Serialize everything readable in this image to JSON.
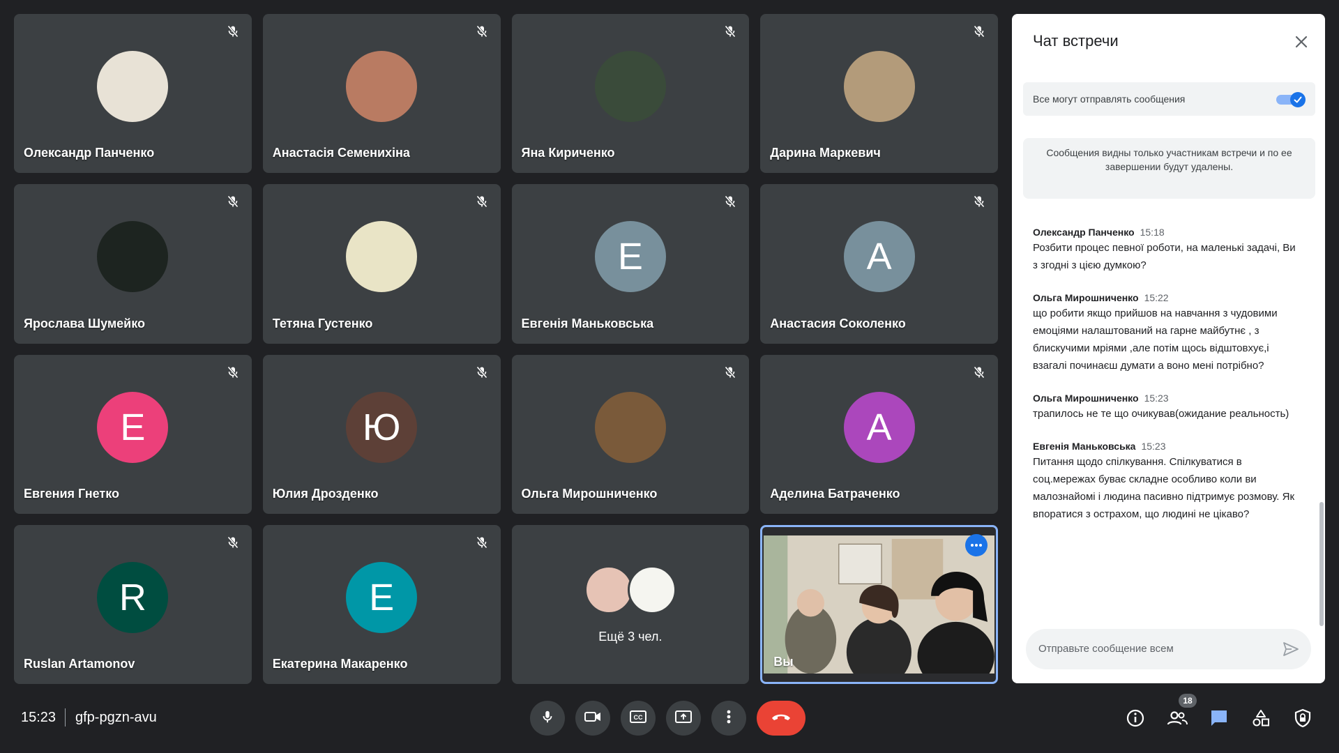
{
  "participants": [
    {
      "name": "Олександр Панченко",
      "initial": "",
      "avatar_color": "#e8e2d6",
      "muted": true
    },
    {
      "name": "Анастасія Семенихіна",
      "initial": "",
      "avatar_color": "#b97b62",
      "muted": true
    },
    {
      "name": "Яна Кириченко",
      "initial": "",
      "avatar_color": "#3a4b3a",
      "muted": true
    },
    {
      "name": "Дарина Маркевич",
      "initial": "",
      "avatar_color": "#b39b7a",
      "muted": true
    },
    {
      "name": "Ярослава Шумейко",
      "initial": "",
      "avatar_color": "#1d2420",
      "muted": true
    },
    {
      "name": "Тетяна Густенко",
      "initial": "",
      "avatar_color": "#e9e4c6",
      "muted": true
    },
    {
      "name": "Евгенія Маньковська",
      "initial": "Е",
      "avatar_color": "#78909c",
      "muted": true
    },
    {
      "name": "Анастасия Соколенко",
      "initial": "А",
      "avatar_color": "#78909c",
      "muted": true
    },
    {
      "name": "Евгения Гнетко",
      "initial": "Е",
      "avatar_color": "#ec407a",
      "muted": true
    },
    {
      "name": "Юлия Дрозденко",
      "initial": "Ю",
      "avatar_color": "#5d4037",
      "muted": true
    },
    {
      "name": "Ольга Мирошниченко",
      "initial": "",
      "avatar_color": "#7a5a3a",
      "muted": true
    },
    {
      "name": "Аделина Батраченко",
      "initial": "А",
      "avatar_color": "#ab47bc",
      "muted": true
    },
    {
      "name": "Ruslan Artamonov",
      "initial": "R",
      "avatar_color": "#004d40",
      "muted": true
    },
    {
      "name": "Екатерина Макаренко",
      "initial": "Е",
      "avatar_color": "#0097a7",
      "muted": true
    }
  ],
  "more_tile": {
    "label": "Ещё 3 чел."
  },
  "self_tile": {
    "label": "Вы"
  },
  "chat": {
    "title": "Чат встречи",
    "toggle_label": "Все могут отправлять сообщения",
    "toggle_on": true,
    "notice": "Сообщения видны только участникам встречи и по ее завершении будут удалены.",
    "messages": [
      {
        "sender": "Олександр Панченко",
        "time": "15:18",
        "text": "Розбити процес певної роботи, на маленькі задачі, Ви з згодні з цією думкою?"
      },
      {
        "sender": "Ольга Мирошниченко",
        "time": "15:22",
        "text": "що робити якщо прийшов на навчання з чудовими емоціями налаштований на гарне майбутнє , з блискучими мріями ,але потім щось відштовхує,і взагалі починаєш думати а воно мені потрібно?"
      },
      {
        "sender": "Ольга Мирошниченко",
        "time": "15:23",
        "text": "трапилось не те що очикував(ожидание реальность)"
      },
      {
        "sender": "Евгенія Маньковська",
        "time": "15:23",
        "text": "Питання щодо спілкування. Спілкуватися в соц.мережах буває складне особливо коли ви малознайомі і людина пасивно підтримує розмову. Як впоратися з острахом, що людині не цікаво?"
      }
    ],
    "input_placeholder": "Отправьте сообщение всем"
  },
  "bottom_bar": {
    "time": "15:23",
    "meeting_code": "gfp-pgzn-avu",
    "controls": [
      "mic-icon",
      "camera-icon",
      "captions-icon",
      "present-icon",
      "more-vert-icon",
      "end-call-icon"
    ],
    "right_icons": [
      "info-icon",
      "people-icon",
      "chat-icon",
      "activities-icon",
      "host-controls-icon"
    ],
    "participants_count": "18"
  },
  "colors": {
    "accent": "#1a73e8",
    "end_call": "#ea4335",
    "tile": "#3c4043",
    "background": "#202124",
    "active_chat_icon": "#8ab4f8"
  }
}
